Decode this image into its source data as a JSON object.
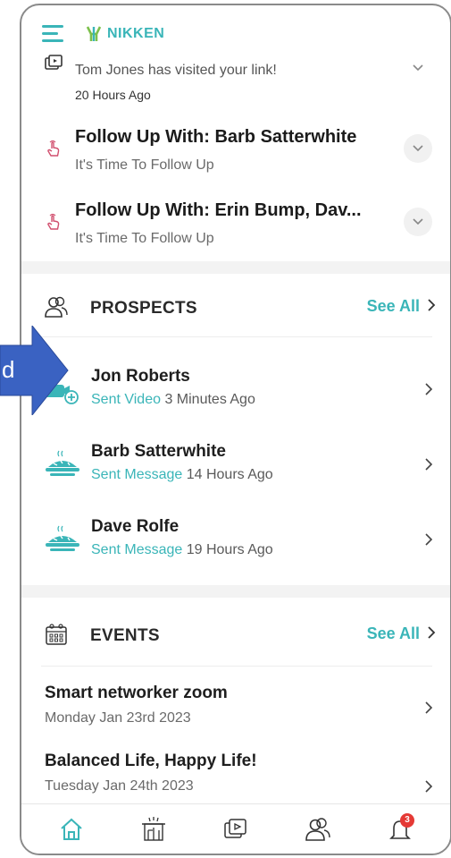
{
  "app": {
    "logo_text": "NIKKEN"
  },
  "colors": {
    "accent": "#3ab5b8",
    "badge": "#e53935"
  },
  "notifications": [
    {
      "icon": "video-share-icon",
      "title": "Tom Jones has visited your link!",
      "sub": "20 Hours Ago"
    },
    {
      "icon": "tap-hand-icon",
      "title": "Follow Up With: Barb Satterwhite",
      "sub": "It's Time To Follow Up"
    },
    {
      "icon": "tap-hand-icon",
      "title": "Follow Up With: Erin Bump, Dav...",
      "sub": "It's Time To Follow Up"
    }
  ],
  "prospects": {
    "title": "PROSPECTS",
    "see_all": "See All",
    "items": [
      {
        "name": "Jon Roberts",
        "action": "Sent Video",
        "time": "3 Minutes Ago",
        "icon": "video-add-icon"
      },
      {
        "name": "Barb Satterwhite",
        "action": "Sent Message",
        "time": "14 Hours Ago",
        "icon": "warm-pie-icon"
      },
      {
        "name": "Dave Rolfe",
        "action": "Sent Message",
        "time": "19 Hours Ago",
        "icon": "warm-pie-icon"
      }
    ]
  },
  "events": {
    "title": "EVENTS",
    "see_all": "See All",
    "items": [
      {
        "name": "Smart networker zoom",
        "date": "Monday Jan 23rd 2023"
      },
      {
        "name": "Balanced Life, Happy Life!",
        "date": "Tuesday Jan 24th 2023"
      }
    ]
  },
  "bottom_nav": {
    "items": [
      "home-icon",
      "events-icon",
      "media-icon",
      "prospects-icon",
      "notifications-icon"
    ],
    "badge_count": "3"
  },
  "overlay": {
    "text": "d"
  }
}
